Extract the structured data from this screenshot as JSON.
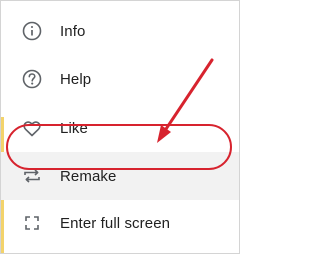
{
  "menu": {
    "items": [
      {
        "icon": "info-icon",
        "label": "Info"
      },
      {
        "icon": "help-icon",
        "label": "Help"
      },
      {
        "icon": "heart-icon",
        "label": "Like"
      },
      {
        "icon": "repeat-icon",
        "label": "Remake",
        "highlighted": true
      },
      {
        "icon": "fullscreen-icon",
        "label": "Enter full screen"
      }
    ]
  },
  "colors": {
    "annotation": "#d7232e",
    "highlight_background": "#f2f2f2",
    "icon": "#5f6368",
    "text": "#212121",
    "side_strip": "#f3d36b"
  }
}
